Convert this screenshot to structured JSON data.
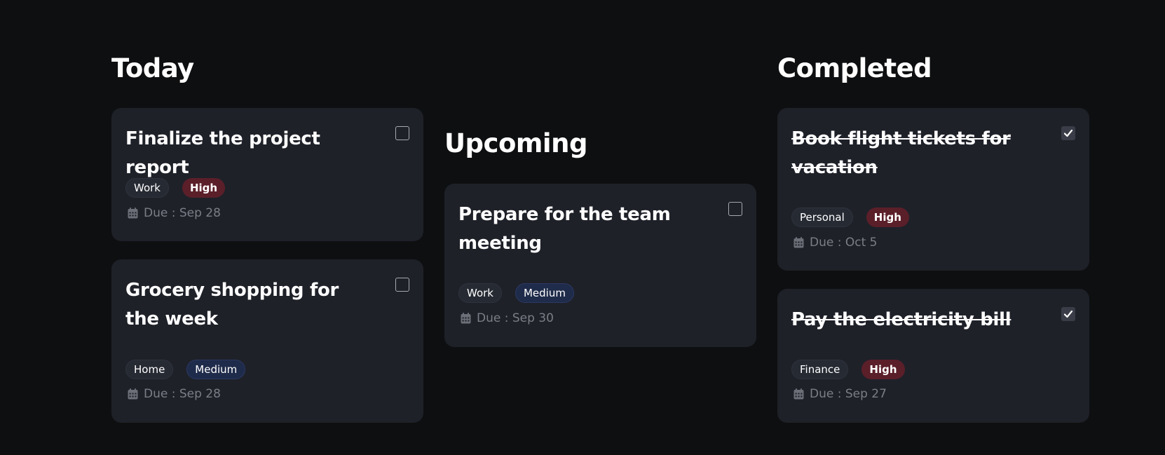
{
  "columns": {
    "today": {
      "title": "Today",
      "cards": [
        {
          "title": "Finalize the project report",
          "checked": false,
          "category": "Work",
          "priority": "High",
          "due_label": "Due : Sep 28"
        },
        {
          "title": "Grocery shopping for the week",
          "checked": false,
          "category": "Home",
          "priority": "Medium",
          "due_label": "Due : Sep 28"
        }
      ]
    },
    "upcoming": {
      "title": "Upcoming",
      "cards": [
        {
          "title": "Prepare for the team meeting",
          "checked": false,
          "category": "Work",
          "priority": "Medium",
          "due_label": "Due : Sep 30"
        }
      ]
    },
    "completed": {
      "title": "Completed",
      "cards": [
        {
          "title": "Book flight tickets for vacation",
          "checked": true,
          "category": "Personal",
          "priority": "High",
          "due_label": "Due : Oct 5"
        },
        {
          "title": "Pay the electricity bill",
          "checked": true,
          "category": "Finance",
          "priority": "High",
          "due_label": "Due : Sep 27"
        }
      ]
    }
  },
  "icons": {
    "calendar": "calendar-icon",
    "check": "check-icon"
  },
  "colors": {
    "background": "#0e0f11",
    "card": "#1f2129",
    "priority_high": "#5b1f29",
    "priority_medium": "#1f2b4a",
    "muted_text": "#7b7e86"
  }
}
